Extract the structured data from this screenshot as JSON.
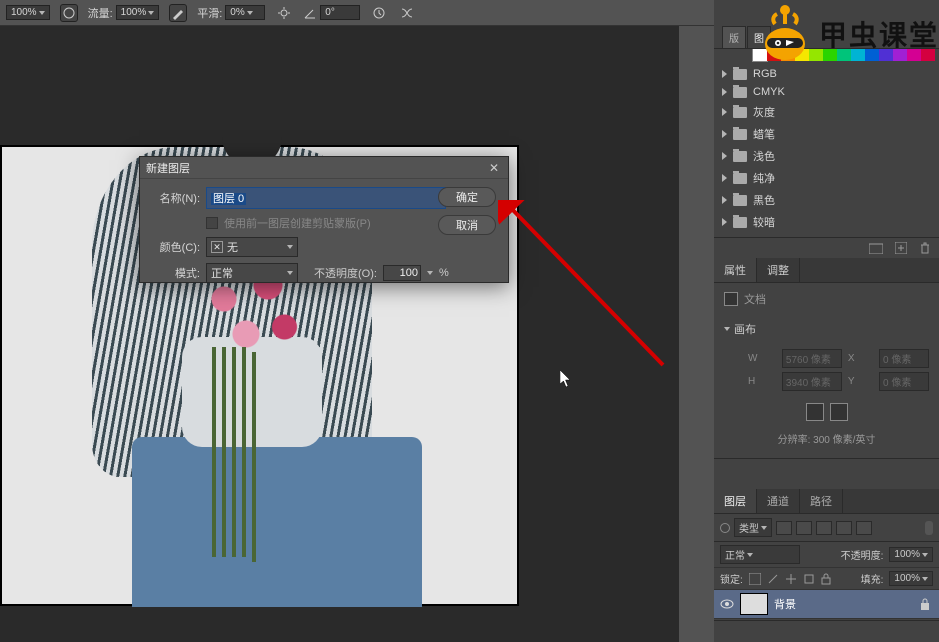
{
  "toolbar": {
    "zoom": "100%",
    "flow_label": "流量:",
    "flow_val": "100%",
    "smooth_label": "平滑:",
    "smooth_val": "0%",
    "angle_label": "",
    "angle_val": "0°"
  },
  "dialog": {
    "title": "新建图层",
    "name_label": "名称(N):",
    "name_value": "图层 0",
    "clip_label": "使用前一图层创建剪贴蒙版(P)",
    "color_label": "颜色(C):",
    "color_val": "无",
    "mode_label": "模式:",
    "mode_val": "正常",
    "opacity_label": "不透明度(O):",
    "opacity_val": "100",
    "opacity_pct": "%",
    "ok": "确定",
    "cancel": "取消"
  },
  "panels": {
    "tabs": [
      "版",
      "图"
    ],
    "swatches": [
      "#ffffff",
      "#d41010",
      "#f5d400",
      "#f5f500",
      "#a3e600",
      "#34d400",
      "#00c47a",
      "#00b4d4",
      "#0060d4",
      "#4020d4",
      "#a020d4",
      "#d40093",
      "#d40040"
    ],
    "folders": [
      "RGB",
      "CMYK",
      "灰度",
      "蜡笔",
      "浅色",
      "纯净",
      "黑色",
      "较暗"
    ],
    "props_tab_a": "属性",
    "props_tab_b": "调整",
    "doc_label": "文档",
    "canvas_label": "画布",
    "w": "W",
    "wval": "5760 像素",
    "x": "X",
    "xval": "0 像素",
    "h": "H",
    "hval": "3940 像素",
    "y": "Y",
    "yval": "0 像素",
    "res": "分辨率: 300 像素/英寸",
    "layers_tab_a": "图层",
    "layers_tab_b": "通道",
    "layers_tab_c": "路径",
    "kind": "类型",
    "blend": "正常",
    "opacity_l": "不透明度:",
    "opacity_v": "100%",
    "lock_l": "锁定:",
    "fill_l": "填充:",
    "fill_v": "100%",
    "bg": "背景"
  },
  "watermark": "甲虫课堂"
}
